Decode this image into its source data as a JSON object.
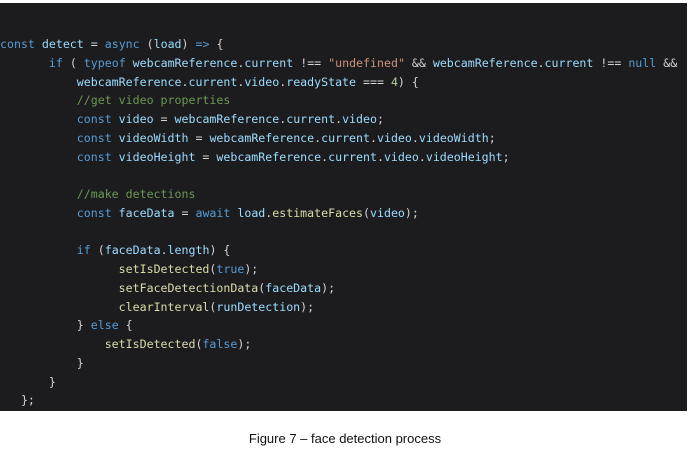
{
  "code": {
    "lines": [
      [
        [
          "const",
          "k"
        ],
        [
          " ",
          "w"
        ],
        [
          "detect",
          "v"
        ],
        [
          " = ",
          "w"
        ],
        [
          "async",
          "k"
        ],
        [
          " (",
          "w"
        ],
        [
          "load",
          "v"
        ],
        [
          ") ",
          "w"
        ],
        [
          "=>",
          "k"
        ],
        [
          " {",
          "w"
        ]
      ],
      [
        [
          "       ",
          "w"
        ],
        [
          "if",
          "k"
        ],
        [
          " ( ",
          "w"
        ],
        [
          "typeof",
          "k"
        ],
        [
          " ",
          "w"
        ],
        [
          "webcamReference",
          "v"
        ],
        [
          ".",
          "w"
        ],
        [
          "current",
          "v"
        ],
        [
          " !== ",
          "w"
        ],
        [
          "\"undefined\"",
          "s"
        ],
        [
          " && ",
          "w"
        ],
        [
          "webcamReference",
          "v"
        ],
        [
          ".",
          "w"
        ],
        [
          "current",
          "v"
        ],
        [
          " !== ",
          "w"
        ],
        [
          "null",
          "k"
        ],
        [
          " &&",
          "w"
        ]
      ],
      [
        [
          "           ",
          "w"
        ],
        [
          "webcamReference",
          "v"
        ],
        [
          ".",
          "w"
        ],
        [
          "current",
          "v"
        ],
        [
          ".",
          "w"
        ],
        [
          "video",
          "v"
        ],
        [
          ".",
          "w"
        ],
        [
          "readyState",
          "v"
        ],
        [
          " === ",
          "w"
        ],
        [
          "4",
          "n"
        ],
        [
          ") {",
          "w"
        ]
      ],
      [
        [
          "           ",
          "w"
        ],
        [
          "//get video properties",
          "c"
        ]
      ],
      [
        [
          "           ",
          "w"
        ],
        [
          "const",
          "k"
        ],
        [
          " ",
          "w"
        ],
        [
          "video",
          "v"
        ],
        [
          " = ",
          "w"
        ],
        [
          "webcamReference",
          "v"
        ],
        [
          ".",
          "w"
        ],
        [
          "current",
          "v"
        ],
        [
          ".",
          "w"
        ],
        [
          "video",
          "v"
        ],
        [
          ";",
          "w"
        ]
      ],
      [
        [
          "           ",
          "w"
        ],
        [
          "const",
          "k"
        ],
        [
          " ",
          "w"
        ],
        [
          "videoWidth",
          "v"
        ],
        [
          " = ",
          "w"
        ],
        [
          "webcamReference",
          "v"
        ],
        [
          ".",
          "w"
        ],
        [
          "current",
          "v"
        ],
        [
          ".",
          "w"
        ],
        [
          "video",
          "v"
        ],
        [
          ".",
          "w"
        ],
        [
          "videoWidth",
          "v"
        ],
        [
          ";",
          "w"
        ]
      ],
      [
        [
          "           ",
          "w"
        ],
        [
          "const",
          "k"
        ],
        [
          " ",
          "w"
        ],
        [
          "videoHeight",
          "v"
        ],
        [
          " = ",
          "w"
        ],
        [
          "webcamReference",
          "v"
        ],
        [
          ".",
          "w"
        ],
        [
          "current",
          "v"
        ],
        [
          ".",
          "w"
        ],
        [
          "video",
          "v"
        ],
        [
          ".",
          "w"
        ],
        [
          "videoHeight",
          "v"
        ],
        [
          ";",
          "w"
        ]
      ],
      [
        [
          "",
          "w"
        ]
      ],
      [
        [
          "           ",
          "w"
        ],
        [
          "//make detections",
          "c"
        ]
      ],
      [
        [
          "           ",
          "w"
        ],
        [
          "const",
          "k"
        ],
        [
          " ",
          "w"
        ],
        [
          "faceData",
          "v"
        ],
        [
          " = ",
          "w"
        ],
        [
          "await",
          "k"
        ],
        [
          " ",
          "w"
        ],
        [
          "load",
          "v"
        ],
        [
          ".",
          "w"
        ],
        [
          "estimateFaces",
          "f"
        ],
        [
          "(",
          "w"
        ],
        [
          "video",
          "v"
        ],
        [
          ");",
          "w"
        ]
      ],
      [
        [
          "",
          "w"
        ]
      ],
      [
        [
          "           ",
          "w"
        ],
        [
          "if",
          "k"
        ],
        [
          " (",
          "w"
        ],
        [
          "faceData",
          "v"
        ],
        [
          ".",
          "w"
        ],
        [
          "length",
          "v"
        ],
        [
          ") {",
          "w"
        ]
      ],
      [
        [
          "                 ",
          "w"
        ],
        [
          "setIsDetected",
          "f"
        ],
        [
          "(",
          "w"
        ],
        [
          "true",
          "k"
        ],
        [
          ");",
          "w"
        ]
      ],
      [
        [
          "                 ",
          "w"
        ],
        [
          "setFaceDetectionData",
          "f"
        ],
        [
          "(",
          "w"
        ],
        [
          "faceData",
          "v"
        ],
        [
          ");",
          "w"
        ]
      ],
      [
        [
          "                 ",
          "w"
        ],
        [
          "clearInterval",
          "f"
        ],
        [
          "(",
          "w"
        ],
        [
          "runDetection",
          "v"
        ],
        [
          ");",
          "w"
        ]
      ],
      [
        [
          "           ",
          "w"
        ],
        [
          "} ",
          "w"
        ],
        [
          "else",
          "k"
        ],
        [
          " {",
          "w"
        ]
      ],
      [
        [
          "               ",
          "w"
        ],
        [
          "setIsDetected",
          "f"
        ],
        [
          "(",
          "w"
        ],
        [
          "false",
          "k"
        ],
        [
          ");",
          "w"
        ]
      ],
      [
        [
          "           ",
          "w"
        ],
        [
          "}",
          "w"
        ]
      ],
      [
        [
          "       ",
          "w"
        ],
        [
          "}",
          "w"
        ]
      ],
      [
        [
          "   ",
          "w"
        ],
        [
          "};",
          "w"
        ]
      ]
    ]
  },
  "caption": "Figure 7 – face detection process",
  "colors": {
    "editor_background": "#1c1c1e",
    "keyword": "#569cd6",
    "identifier": "#9cdcfe",
    "punctuation": "#d4d4d4",
    "string": "#ce9178",
    "number": "#b5cea8",
    "comment": "#6a9955",
    "function": "#dcdcaa"
  }
}
